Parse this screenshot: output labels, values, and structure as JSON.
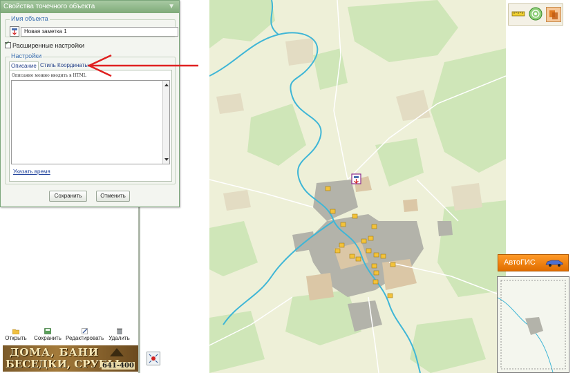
{
  "props_window": {
    "title": "Свойства точечного объекта",
    "name_group_label": "Имя объекта",
    "name_value": "Новая заметка 1",
    "advanced_label": "Расширенные настройки",
    "settings_group_label": "Настройки",
    "tabs": [
      "Описание",
      "Стиль",
      "Координаты"
    ],
    "description_hint": "Описание можно вводить в HTML",
    "time_link": "Указать время",
    "save_label": "Сохранить",
    "cancel_label": "Отменить"
  },
  "toolbar": {
    "open": "Открыть",
    "save": "Сохранить",
    "edit": "Редактировать",
    "delete": "Удалить"
  },
  "banner": {
    "line1": "ДОМА, БАНИ",
    "line2": "БЕСЕДКИ, СРУБЫ",
    "phone": "641-400"
  },
  "map": {
    "avtogis_label": "АвтоГИС"
  },
  "colors": {
    "accent_red": "#e02020",
    "window_title": "#8fb78a",
    "avtogis_orange": "#f08a10",
    "map_bg": "#eef0d8",
    "forest": "#cfe6b8",
    "river": "#3fb6d6",
    "urban": "#b3b3aa",
    "marker": "#f3c23a"
  },
  "icons": {
    "close": "close-icon",
    "note": "note-icon",
    "open": "folder-open-icon",
    "save": "floppy-icon",
    "edit": "edit-icon",
    "delete": "trash-icon",
    "ruler": "ruler-icon",
    "radar": "radar-icon",
    "layers": "layers-icon",
    "car": "car-icon",
    "center": "target-icon"
  }
}
